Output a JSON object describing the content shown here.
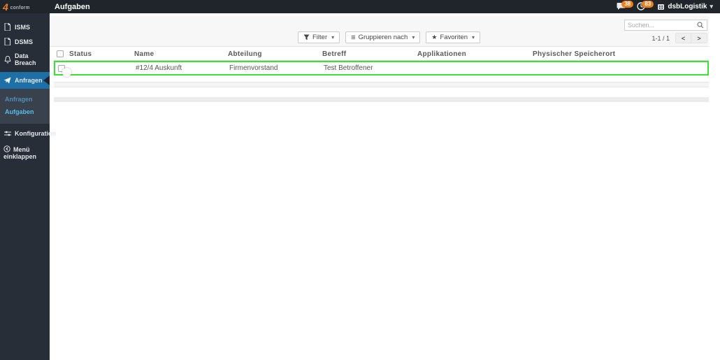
{
  "topbar": {
    "title": "Aufgaben",
    "notifications_count": "38",
    "activities_count": "83",
    "company": "dsbLogistik"
  },
  "sidebar": {
    "logo_mark": "4",
    "logo_text": "conform",
    "items": [
      {
        "label": "ISMS"
      },
      {
        "label": "DSMS"
      },
      {
        "label": "Data Breach"
      },
      {
        "label": "Anfragen"
      },
      {
        "label": "Konfiguration"
      },
      {
        "label": "Menü einklappen"
      }
    ],
    "subitems": [
      {
        "label": "Anfragen"
      },
      {
        "label": "Aufgaben"
      }
    ]
  },
  "controls": {
    "filter_label": "Filter",
    "groupby_label": "Gruppieren nach",
    "favorites_label": "Favoriten",
    "search_placeholder": "Suchen...",
    "pager_text": "1-1 / 1"
  },
  "icons": {
    "caret_down": "▾",
    "star": "★",
    "group_lines": "≡",
    "pager_prev": "<",
    "pager_next": ">"
  },
  "table": {
    "headers": [
      "Status",
      "Name",
      "Abteilung",
      "Betreff",
      "Applikationen",
      "Physischer Speicherort"
    ],
    "rows": [
      {
        "status_toggle": "on",
        "name": "#12/4 Auskunft",
        "abteilung": "Firmenvorstand",
        "betreff": "Test Betroffener",
        "applikationen": "",
        "speicherort": ""
      }
    ]
  },
  "colors": {
    "accent_orange": "#f07e22",
    "badge_orange": "#ef7e1b",
    "active_blue": "#1d6fa7",
    "row_highlight_green": "#35e435",
    "sublink_anfragen": "#4e8fb9",
    "sublink_aufgaben": "#55bdea"
  }
}
